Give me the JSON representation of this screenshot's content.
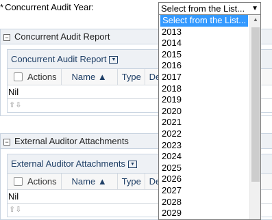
{
  "field": {
    "asterisk": "*",
    "label": "Concurrent Audit Year:"
  },
  "select": {
    "selected": "Select from the List...",
    "arrow": "▼",
    "options": [
      "Select from the List...",
      "2013",
      "2014",
      "2015",
      "2016",
      "2017",
      "2018",
      "2019",
      "2020",
      "2021",
      "2022",
      "2023",
      "2024",
      "2025",
      "2026",
      "2027",
      "2028",
      "2029"
    ]
  },
  "panels": [
    {
      "header": "Concurrent Audit Report",
      "inner_title": "Concurrent Audit Report",
      "columns": {
        "actions": "Actions",
        "name": "Name",
        "type": "Type",
        "desc": "Desc"
      },
      "empty_text": "Nil"
    },
    {
      "header": "External Auditor Attachments",
      "inner_title": "External Auditor Attachments",
      "columns": {
        "actions": "Actions",
        "name": "Name",
        "type": "Type",
        "desc": "Desc"
      },
      "empty_text": "Nil"
    }
  ],
  "icons": {
    "collapse": "minus-box-icon",
    "menu": "column-menu-icon",
    "sort": "sort-up-icon",
    "nav": "page-nav-icon"
  },
  "colors": {
    "selected_bg": "#3399ff",
    "header_text": "#1f3f66",
    "border": "#c8d3e0"
  }
}
